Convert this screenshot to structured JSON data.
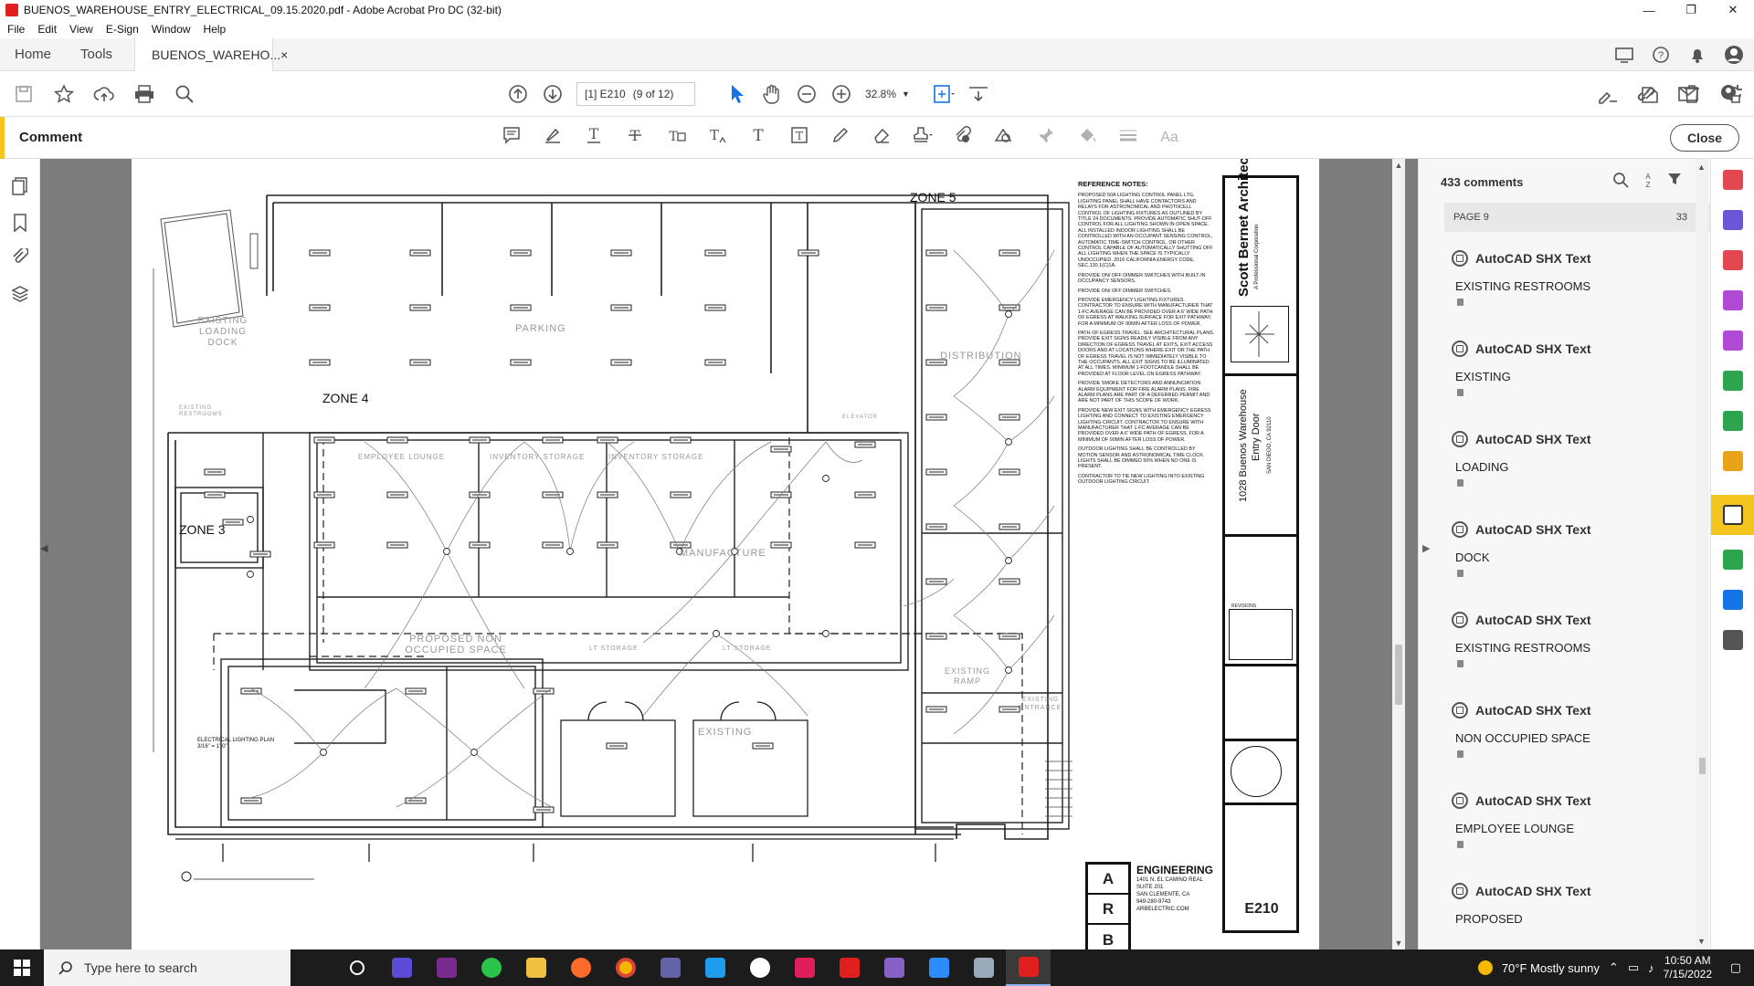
{
  "window": {
    "title": "BUENOS_WAREHOUSE_ENTRY_ELECTRICAL_09.15.2020.pdf - Adobe Acrobat Pro DC (32-bit)",
    "minimize": "—",
    "maximize": "❐",
    "close": "✕"
  },
  "menu": [
    "File",
    "Edit",
    "View",
    "E-Sign",
    "Window",
    "Help"
  ],
  "tabs": {
    "home": "Home",
    "tools": "Tools",
    "document": "BUENOS_WAREHO...",
    "document_close": "×"
  },
  "toolbar": {
    "page_label": "[1] E210",
    "page_count": "(9 of 12)",
    "zoom": "32.8%"
  },
  "comment_bar": {
    "label": "Comment",
    "close": "Close"
  },
  "drawing": {
    "zones": [
      "ZONE 5",
      "ZONE 4",
      "ZONE 3"
    ],
    "rooms": {
      "parking": "PARKING",
      "existing_loading": "EXISTING LOADING DOCK",
      "distribution": "DISTRIBUTION",
      "employee_lounge": "EMPLOYEE LOUNGE",
      "inventory_storage": "INVENTORY STORAGE",
      "inventory_storage2": "INVENTORY STORAGE",
      "manufacture": "MANUFACTURE",
      "proposed_non_occupied": "PROPOSED NON OCCUPIED SPACE",
      "existing_ramp": "EXISTING RAMP",
      "existing_entrance": "EXISTING ENTRANCE",
      "existing": "EXISTING",
      "existing_restrooms": "EXISTING RESTROOMS",
      "elevator": "ELEVATOR",
      "lt_storage1": "LT STORAGE",
      "lt_storage2": "LT STORAGE"
    },
    "plan_caption": "ELECTRICAL LIGHTING PLAN",
    "plan_scale": "3/16\" = 1'-0\"",
    "reference_notes_title": "REFERENCE NOTES:",
    "reference_notes": [
      "PROPOSED 50A LIGHTING CONTROL PANEL LTG. LIGHTING PANEL SHALL HAVE CONTACTORS AND RELAYS FOR ASTRONOMICAL AND PHOTOCELL CONTROL OF LIGHTING FIXTURES AS OUTLINED BY TITLE 24 DOCUMENTS. PROVIDE AUTOMATIC SHUT-OFF CONTROL FOR ALL LIGHTING SHOWN IN OPEN SPACE. ALL INSTALLED INDOOR LIGHTING SHALL BE CONTROLLED WITH AN OCCUPANT SENSING CONTROL, AUTOMATIC TIME-SWITCH CONTROL, OR OTHER CONTROL CAPABLE OF AUTOMATICALLY SHUTTING OFF ALL LIGHTING WHEN THE SPACE IS TYPICALLY UNOCCUPIED. 2016 CALIFORNIA ENERGY CODE, SEC.130.1(C)1A.",
      "PROVIDE ON/ OFF DIMMER SWITCHES WITH BUILT-IN OCCUPANCY SENSORS.",
      "PROVIDE ON/ OFF DIMMER SWITCHES.",
      "PROVIDE EMERGENCY LIGHTING FIXTURES. CONTRACTOR TO ENSURE WITH MANUFACTURER THAT 1-FC AVERAGE CAN BE PROVIDED OVER A 6' WIDE PATH OF EGRESS AT WALKING SURFACE FOR EXIT PATHWAY, FOR A MINIMUM OF 90MIN AFTER LOSS OF POWER.",
      "PATH OF EGRESS TRAVEL. SEE ARCHITECTURAL PLANS. PROVIDE EXIT SIGNS READILY VISIBLE FROM ANY DIRECTION OF EGRESS TRAVEL AT EXITS, EXIT ACCESS DOORS AND AT LOCATIONS WHERE EXIT OR THE PATH OF EGRESS TRAVEL IS NOT IMMEDIATELY VISIBLE TO THE OCCUPANTS. ALL EXIT SIGNS TO BE ILLUMINATED AT ALL TIMES. MINIMUM 1-FOOTCANDLE SHALL BE PROVIDED AT FLOOR LEVEL ON EGRESS PATHWAY.",
      "PROVIDE SMOKE DETECTORS AND ANNUNCIATION ALARM EQUIPMENT FOR FIRE ALARM PLANS. FIRE ALARM PLANS ARE PART OF A DEFERRED PERMIT AND ARE NOT PART OF THIS SCOPE OF WORK.",
      "PROVIDE NEW EXIT SIGNS WITH EMERGENCY EGRESS LIGHTING AND CONNECT TO EXISTING EMERGENCY LIGHTING CIRCUIT. CONTRACTOR TO ENSURE WITH MANUFACTURER THAT 1-FC AVERAGE CAN BE PROVIDED OVER A 6' WIDE PATH OF EGRESS, FOR A MINIMUM OF 90MIN AFTER LOSS OF POWER.",
      "OUTDOOR LIGHTING SHALL BE CONTROLLED BY MOTION SENSOR AND ASTRONOMICAL TIME CLOCK. LIGHTS SHALL BE DIMMED 50% WHEN NO ONE IS PRESENT.",
      "CONTRACTOR TO TIE NEW LIGHTING INTO EXISTING OUTDOOR LIGHTING CIRCUIT."
    ],
    "architect": "Scott Bernet Architects",
    "architect_sub": "A Professional Corporation",
    "project_name": "1028 Buenos Warehouse",
    "project_sub": "Entry Door",
    "project_city": "SAN DIEGO, CA 92110",
    "revisions_label": "REVISIONS",
    "arb_letters": [
      "A",
      "R",
      "B"
    ],
    "engineering": {
      "name": "ENGINEERING",
      "address1": "1401 N. EL CAMINO REAL",
      "address2": "SUITE 201",
      "city": "SAN CLEMENTE, CA",
      "phone": "949-280-9743",
      "web": "ARBELECTRIC.COM"
    },
    "sheet_number": "E210"
  },
  "comments_panel": {
    "count": "433 comments",
    "page_label": "PAGE 9",
    "page_count": "33",
    "items": [
      {
        "author": "AutoCAD SHX Text",
        "text": "EXISTING RESTROOMS"
      },
      {
        "author": "AutoCAD SHX Text",
        "text": "EXISTING"
      },
      {
        "author": "AutoCAD SHX Text",
        "text": "LOADING"
      },
      {
        "author": "AutoCAD SHX Text",
        "text": "DOCK"
      },
      {
        "author": "AutoCAD SHX Text",
        "text": "EXISTING RESTROOMS"
      },
      {
        "author": "AutoCAD SHX Text",
        "text": "NON OCCUPIED SPACE"
      },
      {
        "author": "AutoCAD SHX Text",
        "text": "EMPLOYEE LOUNGE"
      },
      {
        "author": "AutoCAD SHX Text",
        "text": "PROPOSED"
      }
    ]
  },
  "taskbar": {
    "search_placeholder": "Type here to search",
    "weather": "70°F  Mostly sunny",
    "time": "10:50 AM",
    "date": "7/15/2022"
  },
  "colors": {
    "accent_yellow": "#f4c51e",
    "acrobat_red": "#e0201e",
    "doc_background": "#7d7d7d",
    "taskbar": "#1c1c1c"
  }
}
